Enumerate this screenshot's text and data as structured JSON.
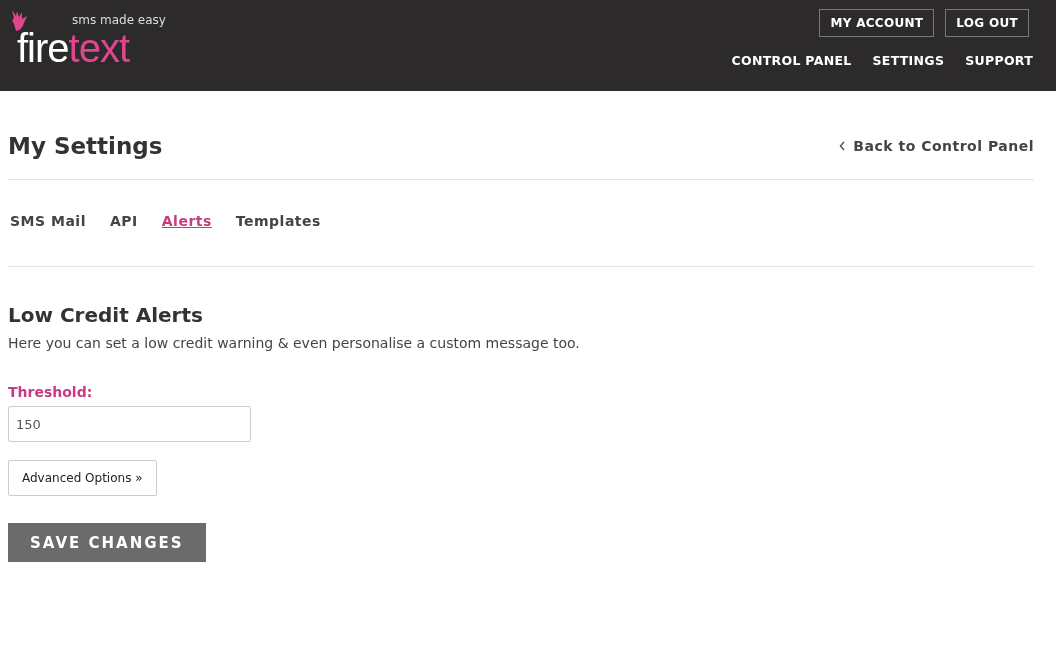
{
  "header": {
    "logo": {
      "first": "fire",
      "second": "text",
      "tagline": "sms made easy"
    },
    "account_buttons": [
      "MY ACCOUNT",
      "LOG OUT"
    ],
    "nav": [
      "CONTROL PANEL",
      "SETTINGS",
      "SUPPORT"
    ]
  },
  "page": {
    "title": "My Settings",
    "back_link": "Back to Control Panel"
  },
  "tabs": [
    {
      "label": "SMS Mail",
      "selected": false
    },
    {
      "label": "API",
      "selected": false
    },
    {
      "label": "Alerts",
      "selected": true
    },
    {
      "label": "Templates",
      "selected": false
    }
  ],
  "section": {
    "heading": "Low Credit Alerts",
    "description": "Here you can set a low credit warning & even personalise a custom message too.",
    "threshold": {
      "label": "Threshold:",
      "value": "150"
    },
    "advanced_button": "Advanced Options »",
    "save_button": "SAVE CHANGES"
  }
}
